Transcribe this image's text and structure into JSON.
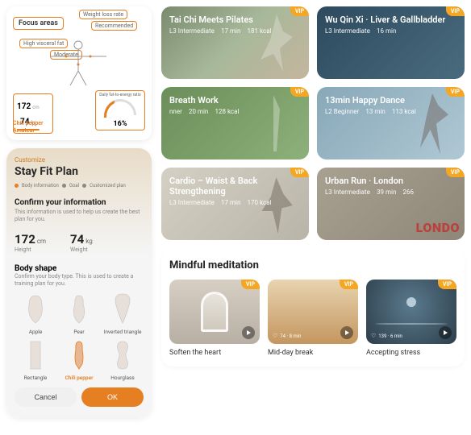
{
  "focus": {
    "title": "Focus areas",
    "tags": {
      "weight": "Weight loss rate",
      "recommended": "Recommended",
      "visceral": "High visceral fat",
      "level": "Moderate"
    },
    "hcm": "172",
    "wkg": "74",
    "body_type": "Chili pepper",
    "fitness_level": "Amateur",
    "gauge_title": "Daily fat-to-energy ratio",
    "gauge_value": "16%"
  },
  "plan": {
    "customize": "Customize",
    "title": "Stay Fit Plan",
    "steps": [
      "Body information",
      "Goal",
      "Customized plan"
    ],
    "confirm_title": "Confirm your information",
    "confirm_sub": "This information is used to help us create the best plan for you.",
    "height_val": "172",
    "height_unit": "cm",
    "height_lbl": "Height",
    "weight_val": "74",
    "weight_unit": "kg",
    "weight_lbl": "Weight",
    "body_shape_title": "Body shape",
    "body_shape_sub": "Confirm your body type. This is used to create a training plan for you.",
    "shapes": [
      "Apple",
      "Pear",
      "Inverted triangle",
      "Rectangle",
      "Chili pepper",
      "Hourglass"
    ],
    "selected_shape_index": 4,
    "cancel": "Cancel",
    "ok": "OK"
  },
  "workouts": [
    {
      "title": "Tai Chi Meets Pilates",
      "level": "L3 Intermediate",
      "time": "17 min",
      "kcal": "181 kcal",
      "cls": "card-taichi",
      "vip": true
    },
    {
      "title": "Wu Qin Xi · Liver & Gallbladder",
      "level": "L3 Intermediate",
      "time": "16 min",
      "kcal": "",
      "cls": "card-wuqin",
      "vip": true
    },
    {
      "title": "Breath Work",
      "level": "nner",
      "time": "20 min",
      "kcal": "128 kcal",
      "cls": "card-breath",
      "vip": true
    },
    {
      "title": "13min Happy Dance",
      "level": "L2 Beginner",
      "time": "13 min",
      "kcal": "113 kcal",
      "cls": "card-dance",
      "vip": true
    },
    {
      "title": "Cardio – Waist & Back Strengthening",
      "level": "L3 Intermediate",
      "time": "17 min",
      "kcal": "170 kcal",
      "cls": "card-cardio",
      "vip": true
    },
    {
      "title": "Urban Run · London",
      "level": "L3 Intermediate",
      "time": "39 min",
      "kcal": "266",
      "cls": "card-urban",
      "vip": true,
      "overlay": "LONDO"
    }
  ],
  "meditation": {
    "title": "Mindful meditation",
    "items": [
      {
        "name": "Soften the heart",
        "meta": "",
        "cls": "thumb-soften",
        "vip": true
      },
      {
        "name": "Mid-day break",
        "meta": "74 · 8 min",
        "cls": "thumb-midday",
        "vip": true
      },
      {
        "name": "Accepting stress",
        "meta": "139 · 6 min",
        "cls": "thumb-stress",
        "vip": true
      }
    ]
  },
  "vip_label": "VIP"
}
